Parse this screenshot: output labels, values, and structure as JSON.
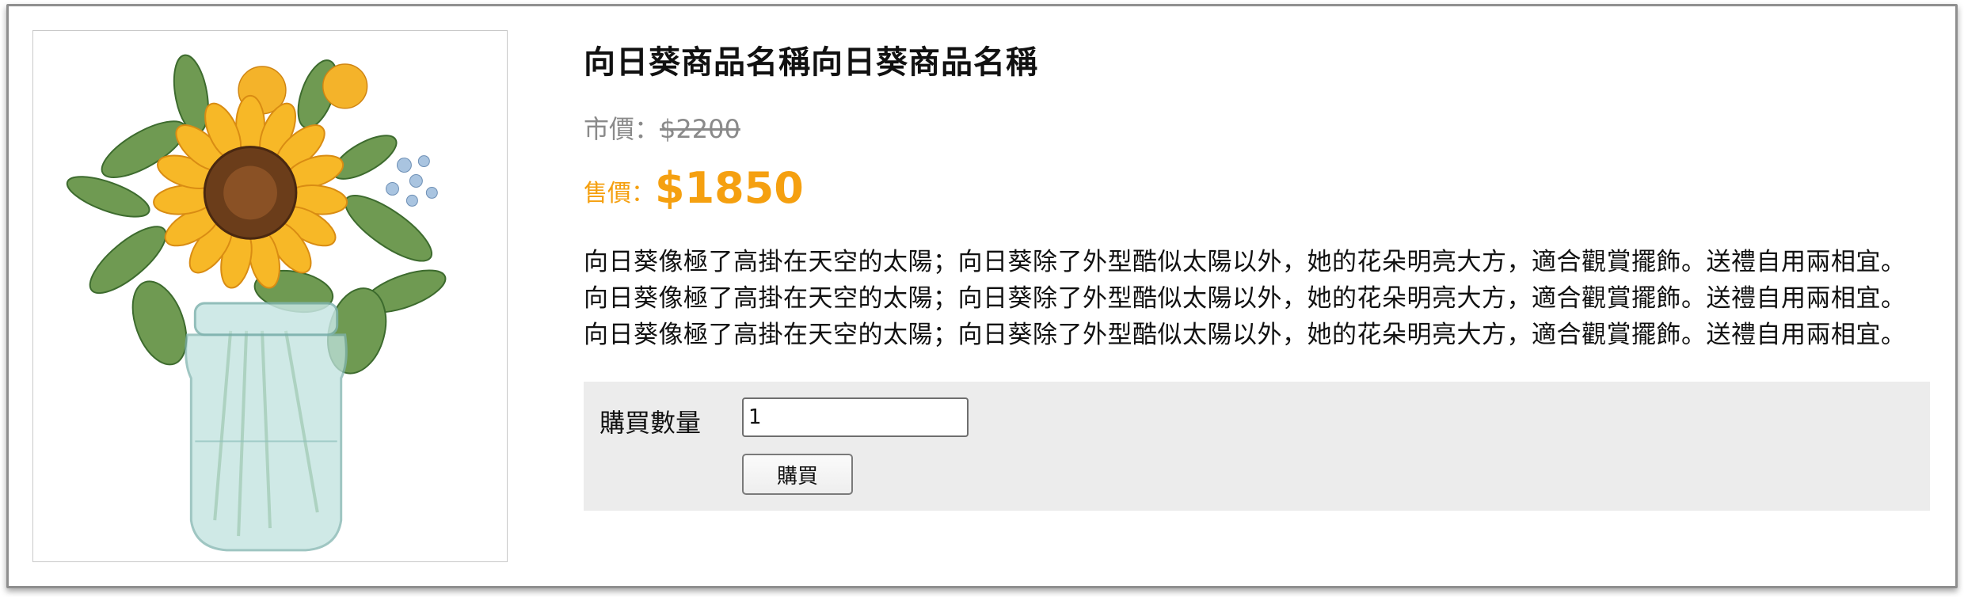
{
  "product": {
    "title": "向日葵商品名稱向日葵商品名稱",
    "image_alt": "sunflower-in-jar",
    "market_price_label": "市價：",
    "market_price": "$2200",
    "sale_price_label": "售價：",
    "sale_price": "$1850",
    "description_lines": [
      "向日葵像極了高掛在天空的太陽；向日葵除了外型酷似太陽以外，她的花朵明亮大方，適合觀賞擺飾。送禮自用兩相宜。",
      "向日葵像極了高掛在天空的太陽；向日葵除了外型酷似太陽以外，她的花朵明亮大方，適合觀賞擺飾。送禮自用兩相宜。",
      "向日葵像極了高掛在天空的太陽；向日葵除了外型酷似太陽以外，她的花朵明亮大方，適合觀賞擺飾。送禮自用兩相宜。"
    ]
  },
  "purchase": {
    "quantity_label": "購買數量",
    "quantity_value": "1",
    "buy_button_label": "購買"
  },
  "colors": {
    "sale_accent": "#f5a010",
    "market_gray": "#8a8a8a",
    "panel_bg": "#ececec"
  }
}
